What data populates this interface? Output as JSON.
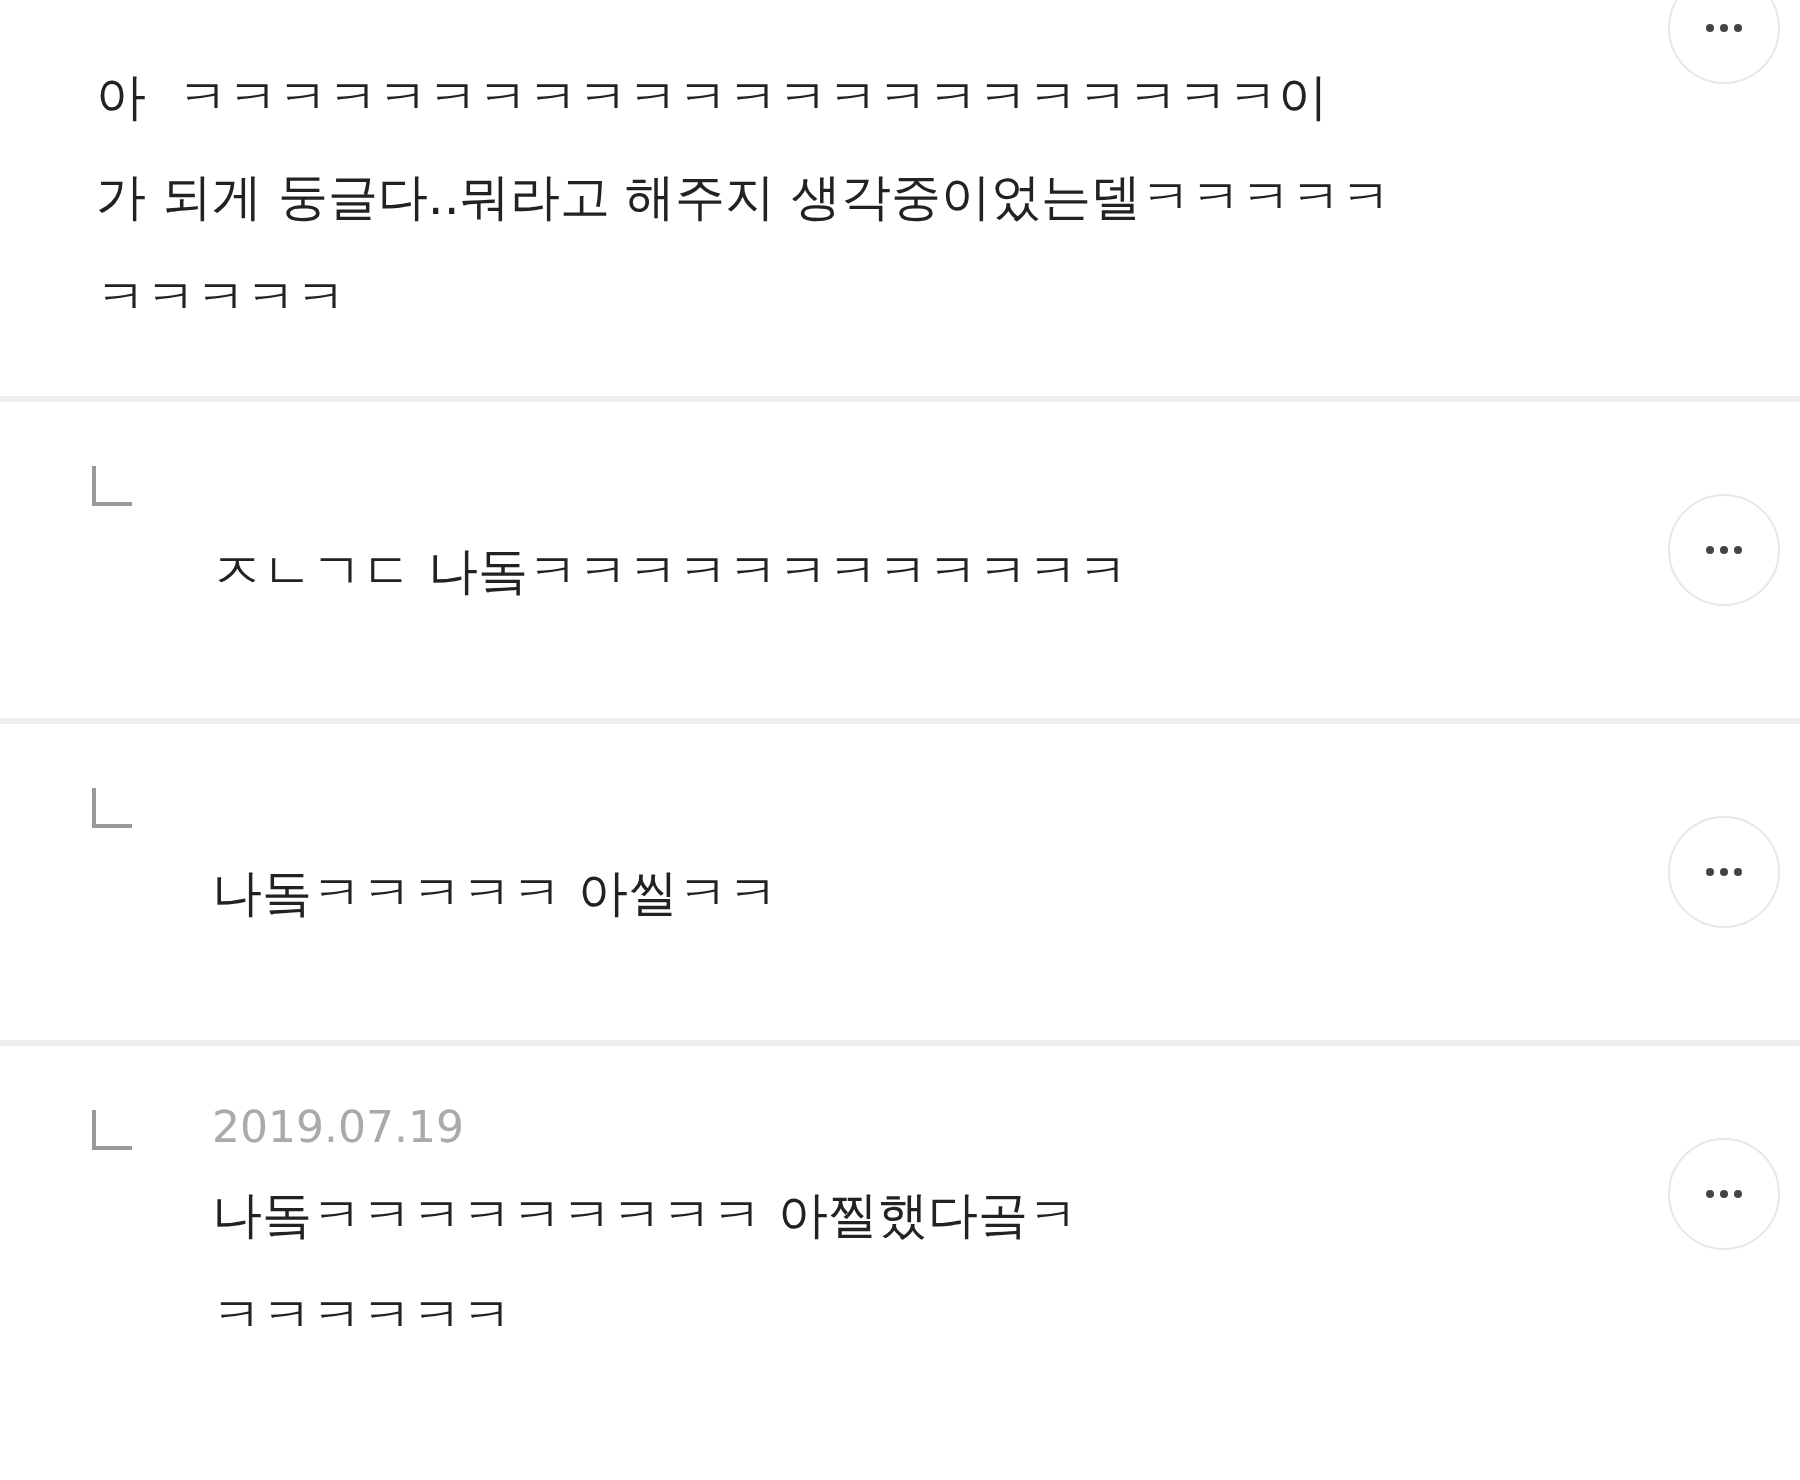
{
  "comment": {
    "lines": [
      "아  ㅋㅋㅋㅋㅋㅋㅋㅋㅋㅋㅋㅋㅋㅋㅋㅋㅋㅋㅋㅋㅋㅋ이",
      "가 되게 둥글다..뭐라고 해주지 생각중이었는델ㅋㅋㅋㅋㅋ",
      "ㅋㅋㅋㅋㅋ"
    ]
  },
  "replies": [
    {
      "lines": [
        "ㅈㄴㄱㄷ 나돜ㅋㅋㅋㅋㅋㅋㅋㅋㅋㅋㅋㅋ"
      ]
    },
    {
      "lines": [
        "나돜ㅋㅋㅋㅋㅋ 아씰ㅋㅋ"
      ]
    },
    {
      "date": "2019.07.19",
      "lines": [
        "나돜ㅋㅋㅋㅋㅋㅋㅋㅋㅋ 아찔했다곸ㅋ",
        "ㅋㅋㅋㅋㅋㅋ"
      ]
    }
  ]
}
